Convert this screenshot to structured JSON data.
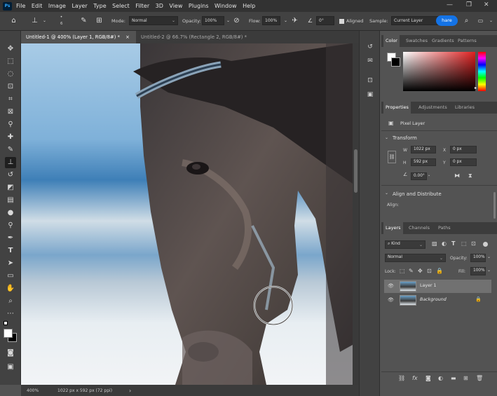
{
  "menubar": {
    "logo": "Ps",
    "items": [
      "File",
      "Edit",
      "Image",
      "Layer",
      "Type",
      "Select",
      "Filter",
      "3D",
      "View",
      "Plugins",
      "Window",
      "Help"
    ],
    "controls": [
      "—",
      "❐",
      "✕"
    ]
  },
  "options": {
    "brush_size": "6",
    "mode_label": "Mode:",
    "mode_value": "Normal",
    "opacity_label": "Opacity:",
    "opacity_value": "100%",
    "flow_label": "Flow:",
    "flow_value": "100%",
    "angle_value": "0°",
    "aligned_label": "Aligned",
    "sample_label": "Sample:",
    "sample_value": "Current Layer",
    "share_label": "hare"
  },
  "tabs": [
    {
      "label": "Untitled-1 @ 400% (Layer 1, RGB/8#) *",
      "close": "×"
    },
    {
      "label": "Untitled-2 @ 66.7% (Rectangle 2, RGB/8#) *",
      "close": "×"
    }
  ],
  "status": {
    "zoom": "400%",
    "doc_info": "1022 px x 592 px (72 ppi)",
    "arrow": "›"
  },
  "color_panel": {
    "tabs": [
      "Color",
      "Swatches",
      "Gradients",
      "Patterns"
    ]
  },
  "properties_panel": {
    "tabs": [
      "Properties",
      "Adjustments",
      "Libraries"
    ],
    "kind": "Pixel Layer",
    "transform_title": "Transform",
    "w_label": "W",
    "w_value": "1022 px",
    "h_label": "H",
    "h_value": "592 px",
    "x_label": "X",
    "x_value": "0 px",
    "y_label": "Y",
    "y_value": "0 px",
    "angle_value": "0.00°",
    "align_title": "Align and Distribute",
    "align_label": "Align:"
  },
  "layers_panel": {
    "tabs": [
      "Layers",
      "Channels",
      "Paths"
    ],
    "kind_label": "Kind",
    "blend_mode": "Normal",
    "opacity_label": "Opacity:",
    "opacity_value": "100%",
    "lock_label": "Lock:",
    "fill_label": "Fill:",
    "fill_value": "100%",
    "layers": [
      {
        "name": "Layer 1",
        "selected": true
      },
      {
        "name": "Background",
        "selected": false
      }
    ]
  },
  "colors": {
    "accent": "#1473e6",
    "panel_bg": "#535353",
    "dark_bg": "#323232"
  }
}
